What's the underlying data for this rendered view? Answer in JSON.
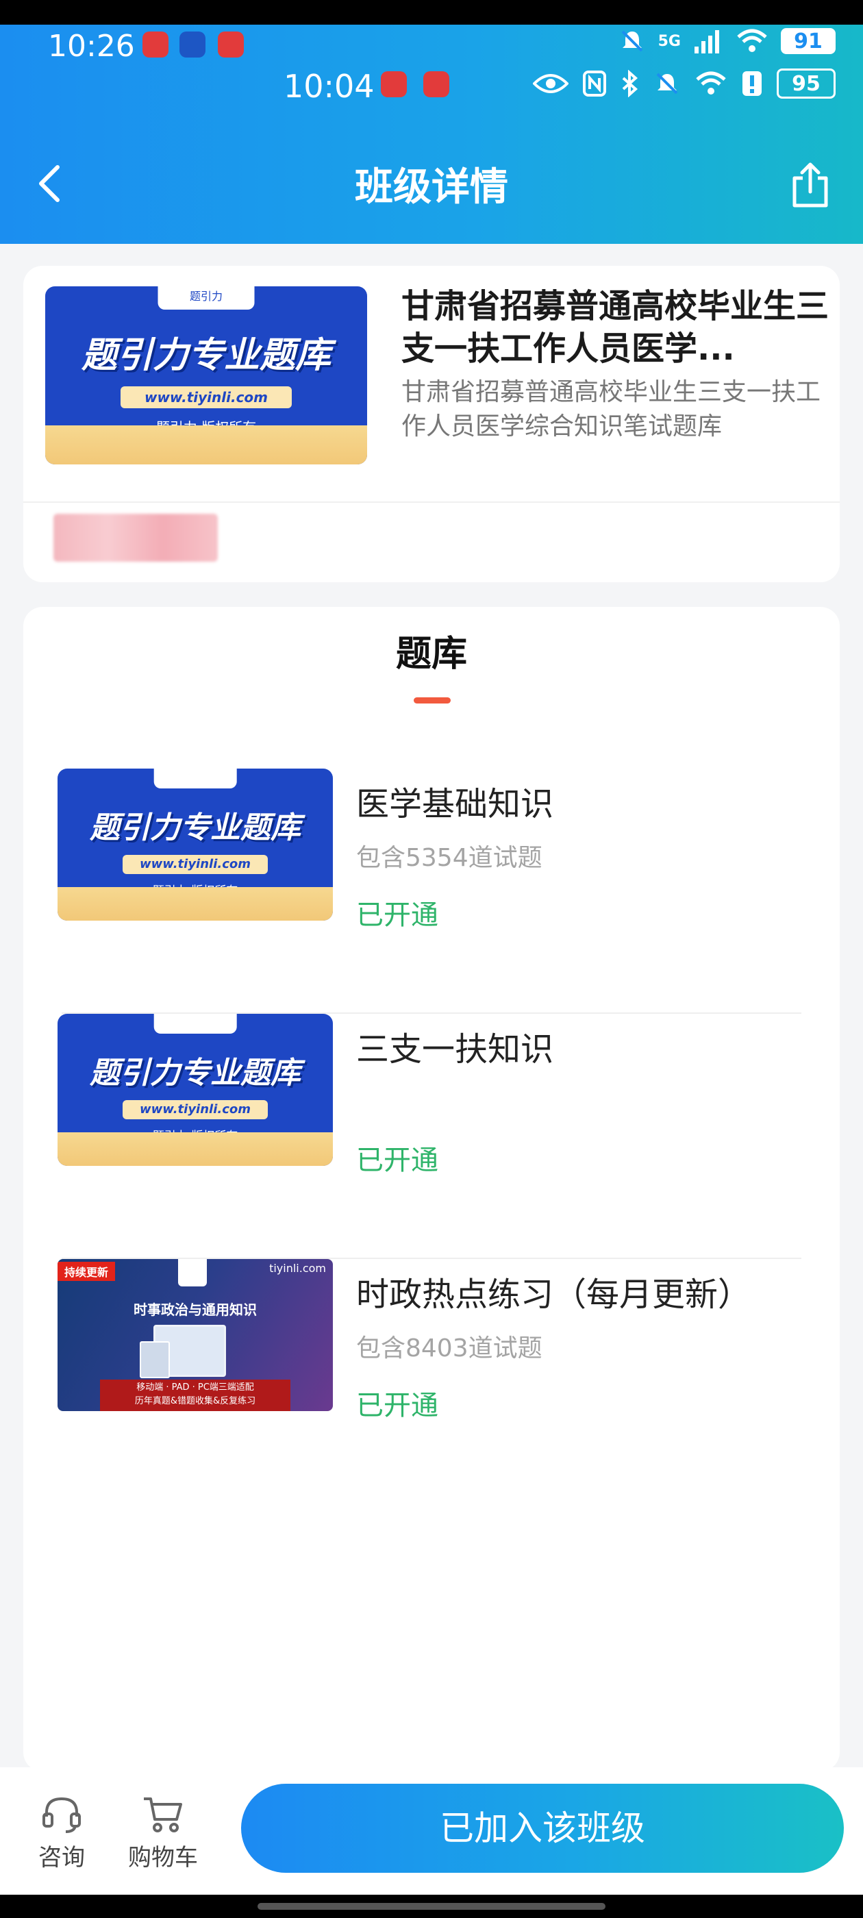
{
  "status_bar": {
    "time_primary": "10:26",
    "time_secondary": "10:04",
    "battery_primary": "91",
    "battery_secondary": "95",
    "network": "5G"
  },
  "header": {
    "title": "班级详情"
  },
  "course_card": {
    "cover": {
      "headline": "题引力专业题库",
      "url": "www.tiyinli.com",
      "copyright": "题引力 版权所有",
      "tag": "题引力"
    },
    "title": "甘肃省招募普通高校毕业生三支一扶工作人员医学...",
    "subtitle": "甘肃省招募普通高校毕业生三支一扶工作人员医学综合知识笔试题库"
  },
  "bank_section": {
    "heading": "题库",
    "items": [
      {
        "title": "医学基础知识",
        "count": "包含5354道试题",
        "status": "已开通",
        "cover_headline": "题引力专业题库",
        "cover_url": "www.tiyinli.com",
        "cover_copyright": "题引力 版权所有"
      },
      {
        "title": "三支一扶知识",
        "count": "",
        "status": "已开通",
        "cover_headline": "题引力专业题库",
        "cover_url": "www.tiyinli.com",
        "cover_copyright": "题引力 版权所有"
      },
      {
        "title": "时政热点练习（每月更新）",
        "count": "包含8403道试题",
        "status": "已开通",
        "cover_badge": "持续更新",
        "cover_site": "tiyinli.com",
        "cover_headline": "时事政治与通用知识",
        "cover_footer_1": "移动端 · PAD · PC端三端适配",
        "cover_footer_2": "历年真题&错题收集&反复练习"
      }
    ]
  },
  "bottom_bar": {
    "consult_label": "咨询",
    "cart_label": "购物车",
    "cta_label": "已加入该班级"
  },
  "colors": {
    "header_gradient_start": "#1b8ef0",
    "header_gradient_end": "#17b8c9",
    "accent_underline": "#f25a3e",
    "status_green": "#2fb46a"
  }
}
